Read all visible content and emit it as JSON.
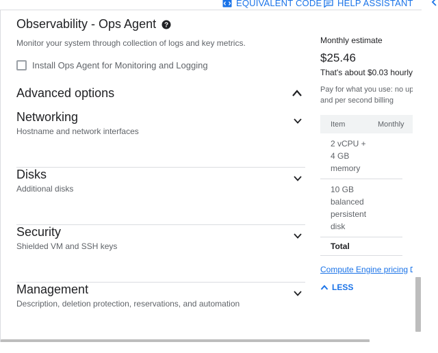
{
  "toolbar": {
    "equivalent_code_label": "EQUIVALENT CODE",
    "help_assistant_label": "HELP ASSISTANT"
  },
  "observability": {
    "title": "Observability - Ops Agent",
    "description": "Monitor your system through collection of logs and key metrics.",
    "checkbox_label": "Install Ops Agent for Monitoring and Logging",
    "checkbox_checked": false
  },
  "advanced": {
    "title": "Advanced options",
    "expanded": true,
    "sections": [
      {
        "title": "Networking",
        "subtitle": "Hostname and network interfaces"
      },
      {
        "title": "Disks",
        "subtitle": "Additional disks"
      },
      {
        "title": "Security",
        "subtitle": "Shielded VM and SSH keys"
      },
      {
        "title": "Management",
        "subtitle": "Description, deletion protection, reservations, and automation"
      }
    ]
  },
  "estimate": {
    "label": "Monthly estimate",
    "price": "$25.46",
    "hourly": "That's about $0.03 hourly",
    "note_line1": "Pay for what you use: no up",
    "note_line2": "and per second billing",
    "table": {
      "headers": [
        "Item",
        "Monthly"
      ],
      "rows": [
        "2 vCPU + 4 GB memory",
        "10 GB balanced persistent disk"
      ],
      "total_label": "Total"
    },
    "pricing_link": "Compute Engine pricing",
    "less_label": "LESS"
  },
  "colors": {
    "accent": "#1a73e8",
    "text_primary": "#202124",
    "text_secondary": "#5f6368",
    "divider": "#dadce0"
  }
}
